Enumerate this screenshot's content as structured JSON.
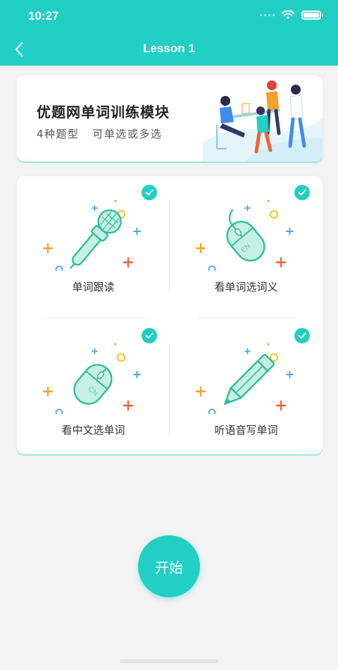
{
  "status_bar": {
    "time": "10:27"
  },
  "nav": {
    "title": "Lesson 1",
    "back_icon": "chevron-left-icon"
  },
  "banner": {
    "title": "优题网单词训练模块",
    "subtitle": "4种题型   可单选或多选"
  },
  "modules": [
    {
      "label": "单词跟读",
      "icon": "microphone-icon",
      "checked": true
    },
    {
      "label": "看单词选词义",
      "icon": "mouse-en-icon",
      "checked": true,
      "mouse_text": "EN"
    },
    {
      "label": "看中文选单词",
      "icon": "mouse-cn-icon",
      "checked": true,
      "mouse_text": "CN"
    },
    {
      "label": "听语音写单词",
      "icon": "pencil-icon",
      "checked": true
    }
  ],
  "start_button": {
    "label": "开始"
  },
  "colors": {
    "accent": "#22cfc4",
    "plus_orange": "#f5a22c",
    "plus_red": "#f0622d",
    "plus_blue": "#4aa8e8",
    "circle_yellow": "#f5c518"
  }
}
